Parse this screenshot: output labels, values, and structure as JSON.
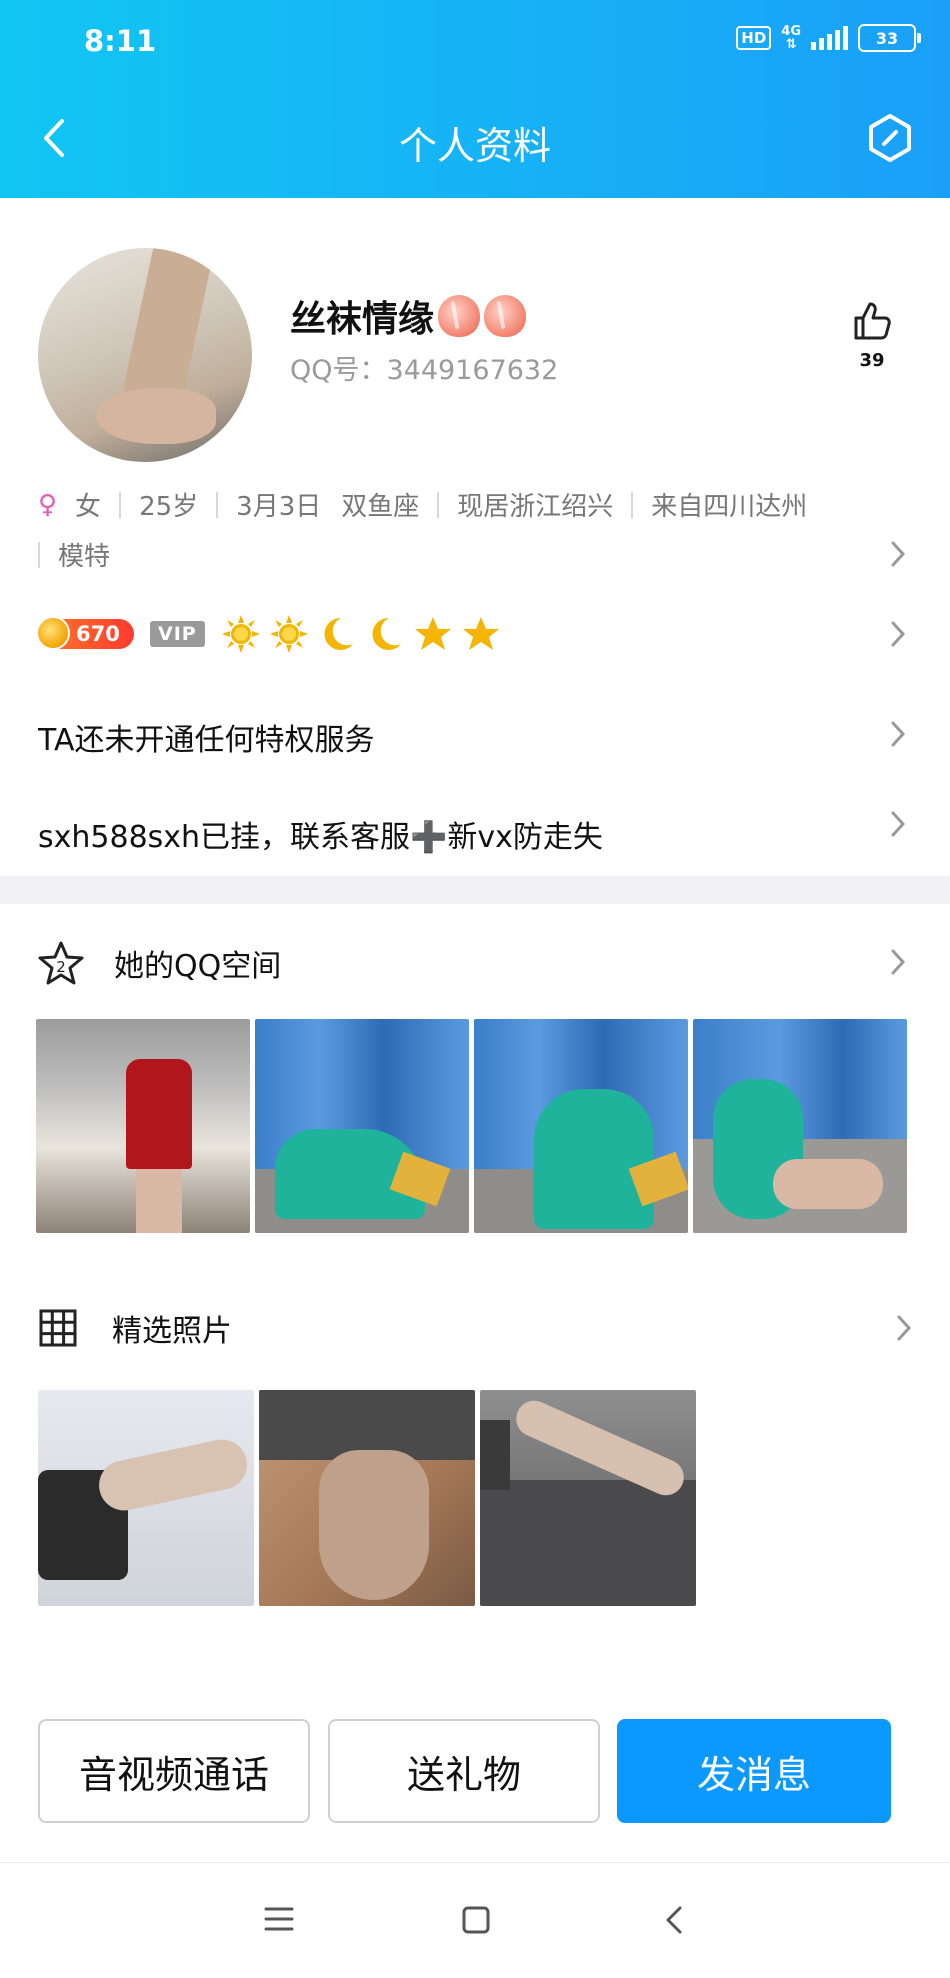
{
  "status_bar": {
    "time": "8:11",
    "hd": "HD",
    "network": "4G",
    "battery": "33"
  },
  "header": {
    "title": "个人资料"
  },
  "profile": {
    "nickname": "丝袜情缘",
    "qq_number": "QQ号：3449167632",
    "like_count": "39",
    "gender": "女",
    "age": "25岁",
    "birthday": "3月3日",
    "zodiac": "双鱼座",
    "location": "现居浙江绍兴",
    "hometown": "来自四川达州",
    "occupation": "模特"
  },
  "level": {
    "coins": "670",
    "vip": "VIP",
    "icons": [
      "sun-icon",
      "sun-icon",
      "moon-icon",
      "moon-icon",
      "star-icon",
      "star-icon"
    ]
  },
  "rows": {
    "privilege": "TA还未开通任何特权服务",
    "signature": "sxh588sxh已挂，联系客服➕新vx防走失"
  },
  "qzone": {
    "title": "她的QQ空间"
  },
  "featured": {
    "title": "精选照片"
  },
  "actions": {
    "call": "音视频通话",
    "gift": "送礼物",
    "message": "发消息"
  },
  "colors": {
    "header_start": "#12c6f3",
    "header_end": "#1aa0f8",
    "primary": "#0b99ff"
  }
}
